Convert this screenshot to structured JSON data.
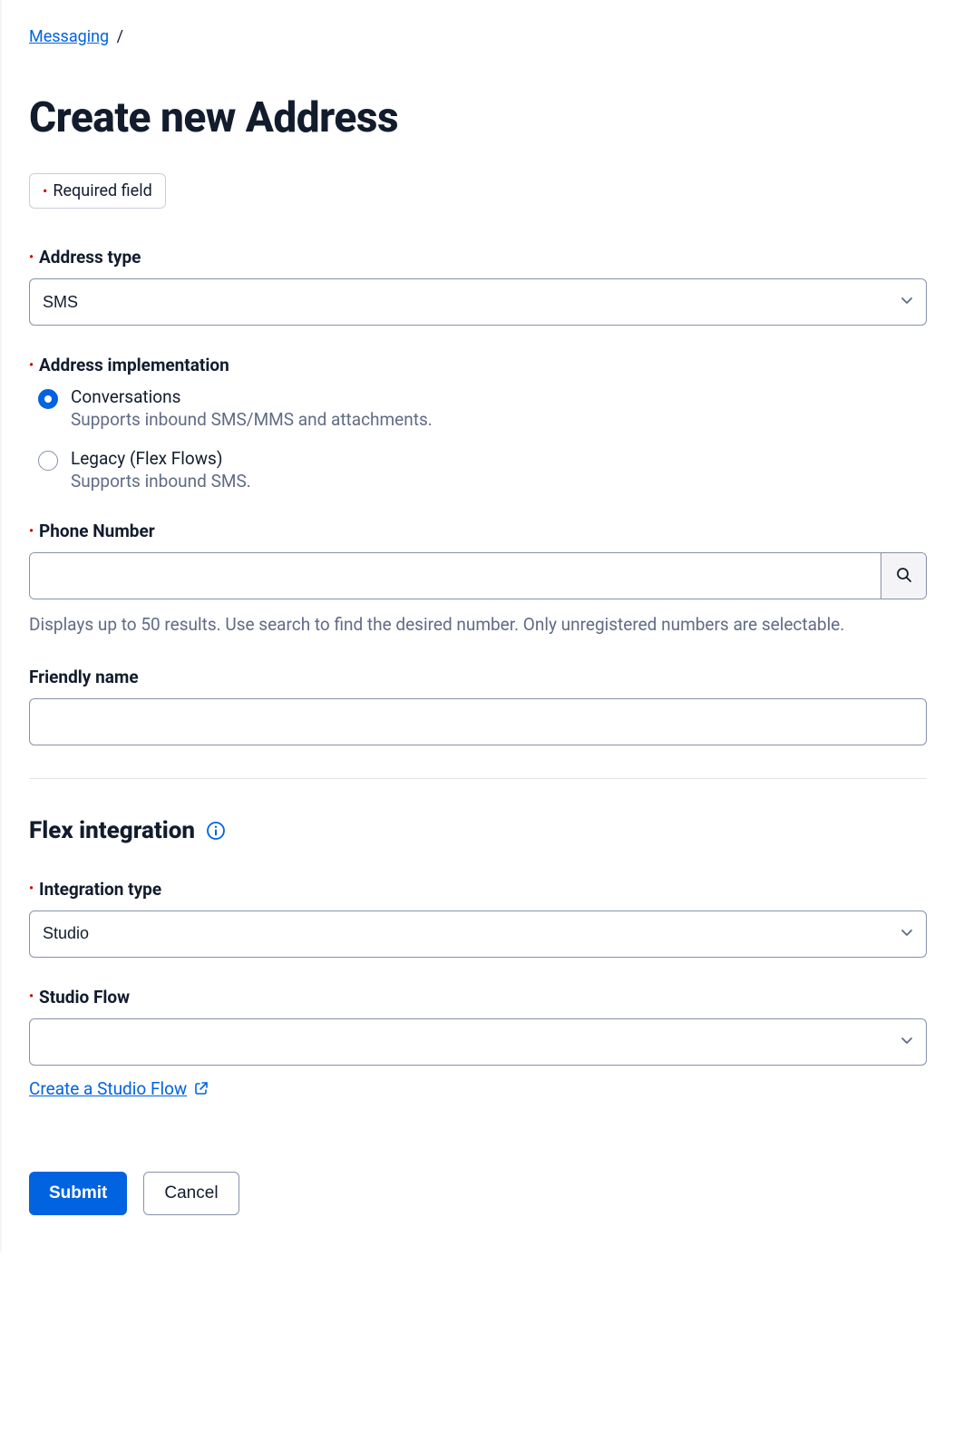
{
  "breadcrumb": {
    "link_text": "Messaging",
    "separator": "/"
  },
  "page_title": "Create new Address",
  "required_badge": "Required field",
  "address_type": {
    "label": "Address type",
    "value": "SMS"
  },
  "address_impl": {
    "label": "Address implementation",
    "options": [
      {
        "title": "Conversations",
        "desc": "Supports inbound SMS/MMS and attachments.",
        "selected": true
      },
      {
        "title": "Legacy (Flex Flows)",
        "desc": "Supports inbound SMS.",
        "selected": false
      }
    ]
  },
  "phone_number": {
    "label": "Phone Number",
    "value": "",
    "help": "Displays up to 50 results. Use search to find the desired number. Only unregistered numbers are selectable."
  },
  "friendly_name": {
    "label": "Friendly name",
    "value": ""
  },
  "flex_integration": {
    "section_title": "Flex integration"
  },
  "integration_type": {
    "label": "Integration type",
    "value": "Studio"
  },
  "studio_flow": {
    "label": "Studio Flow",
    "value": "",
    "create_link": "Create a Studio Flow"
  },
  "buttons": {
    "submit": "Submit",
    "cancel": "Cancel"
  }
}
